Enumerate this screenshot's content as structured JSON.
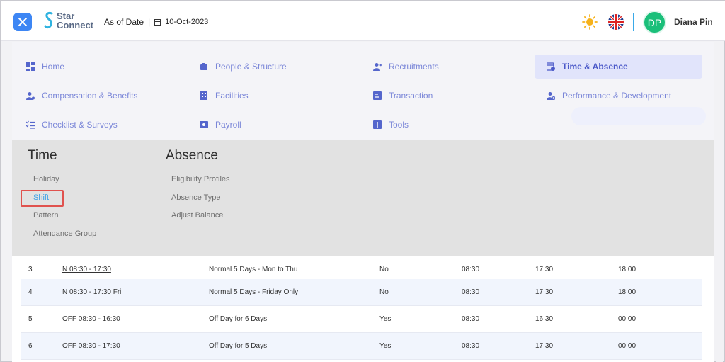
{
  "header": {
    "logo_line1": "Star",
    "logo_line2": "Connect",
    "as_of_label": "As of Date",
    "as_of_date": "10-Oct-2023",
    "avatar_initials": "DP",
    "user_name": "Diana Pin"
  },
  "menu": {
    "items": [
      {
        "label": "Home",
        "icon": "dashboard-icon"
      },
      {
        "label": "People & Structure",
        "icon": "org-chart-icon"
      },
      {
        "label": "Recruitments",
        "icon": "user-add-icon"
      },
      {
        "label": "Time & Absence",
        "icon": "calendar-clock-icon"
      },
      {
        "label": "Compensation & Benefits",
        "icon": "user-money-icon"
      },
      {
        "label": "Facilities",
        "icon": "building-icon"
      },
      {
        "label": "Transaction",
        "icon": "transaction-icon"
      },
      {
        "label": "Performance & Development",
        "icon": "user-gear-icon"
      },
      {
        "label": "Checklist & Surveys",
        "icon": "checklist-icon"
      },
      {
        "label": "Payroll",
        "icon": "payroll-icon"
      },
      {
        "label": "Tools",
        "icon": "tools-icon"
      }
    ],
    "active": "Time & Absence"
  },
  "submenu": {
    "time": {
      "heading": "Time",
      "links": [
        "Holiday",
        "Shift",
        "Pattern",
        "Attendance Group"
      ]
    },
    "absence": {
      "heading": "Absence",
      "links": [
        "Eligibility Profiles",
        "Absence Type",
        "Adjust Balance"
      ]
    },
    "selected": "Shift"
  },
  "table": {
    "rows": [
      {
        "no": "3",
        "code": "N 08:30 - 17:30",
        "description": "Normal 5 Days - Mon to Thu",
        "flag": "No",
        "start": "08:30",
        "end": "17:30",
        "extra": "18:00"
      },
      {
        "no": "4",
        "code": "N 08:30 - 17:30 Fri",
        "description": "Normal 5 Days - Friday Only",
        "flag": "No",
        "start": "08:30",
        "end": "17:30",
        "extra": "18:00"
      },
      {
        "no": "5",
        "code": "OFF 08:30 - 16:30",
        "description": "Off Day for 6 Days",
        "flag": "Yes",
        "start": "08:30",
        "end": "16:30",
        "extra": "00:00"
      },
      {
        "no": "6",
        "code": "OFF 08:30 - 17:30",
        "description": "Off Day for 5 Days",
        "flag": "Yes",
        "start": "08:30",
        "end": "17:30",
        "extra": "00:00"
      }
    ]
  },
  "colors": {
    "accent": "#3d86f4",
    "menu_text": "#7a86d8",
    "active_bg": "#e1e4fb",
    "selected_link": "#3aa0e8",
    "highlight_border": "#e0524e",
    "avatar_bg": "#1bbf7a"
  }
}
